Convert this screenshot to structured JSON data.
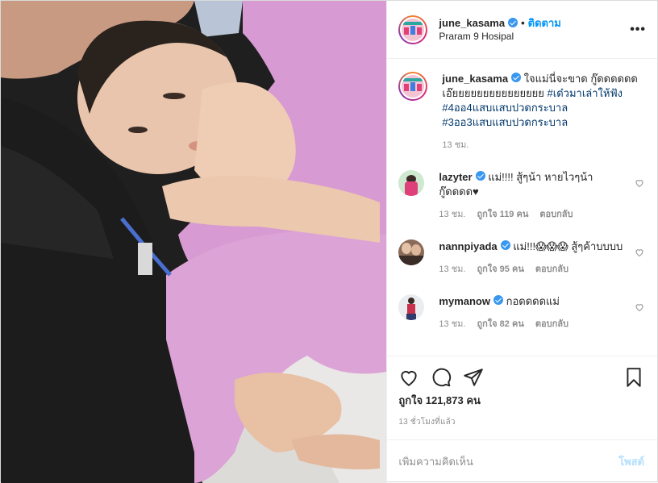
{
  "header": {
    "username": "june_kasama",
    "follow_label": "ติดตาม",
    "location": "Praram 9 Hosipal",
    "more_label": "•••"
  },
  "caption": {
    "username": "june_kasama",
    "text_plain": "ใจแม่นี่จะขาด กู๊ดดดดดดเอ๊ยยยยยยยยยยยยยยย",
    "hashtags": [
      "#เด๋วมาเล่าให้ฟัง",
      "#4ออ4แสบแสบปวดกระบาล",
      "#3ออ3แสบแสบปวดกระบาล"
    ],
    "time": "13 ชม."
  },
  "comments": [
    {
      "username": "lazyter",
      "text": "แม่!!!! สู้ๆน้า หายไวๆน้ากู๊ดดดด♥",
      "time": "13 ชม.",
      "likes": "ถูกใจ 119 คน",
      "reply": "ตอบกลับ"
    },
    {
      "username": "nannpiyada",
      "text": "แม่!!!😱😱😱 สู้ๆค้าบบบบ",
      "time": "13 ชม.",
      "likes": "ถูกใจ 95 คน",
      "reply": "ตอบกลับ"
    },
    {
      "username": "mymanow",
      "text": "กอดดดดแม่",
      "time": "13 ชม.",
      "likes": "ถูกใจ 82 คน",
      "reply": "ตอบกลับ"
    }
  ],
  "actions": {
    "likes_count": "ถูกใจ 121,873 คน",
    "time_ago": "13 ชั่วโมงที่แล้ว"
  },
  "add_comment": {
    "placeholder": "เพิ่มความคิดเห็น",
    "post_label": "โพสต์"
  },
  "colors": {
    "verified": "#3897f0",
    "follow": "#0095f6",
    "hashtag": "#00376b",
    "post_disabled": "#b2dffc"
  }
}
